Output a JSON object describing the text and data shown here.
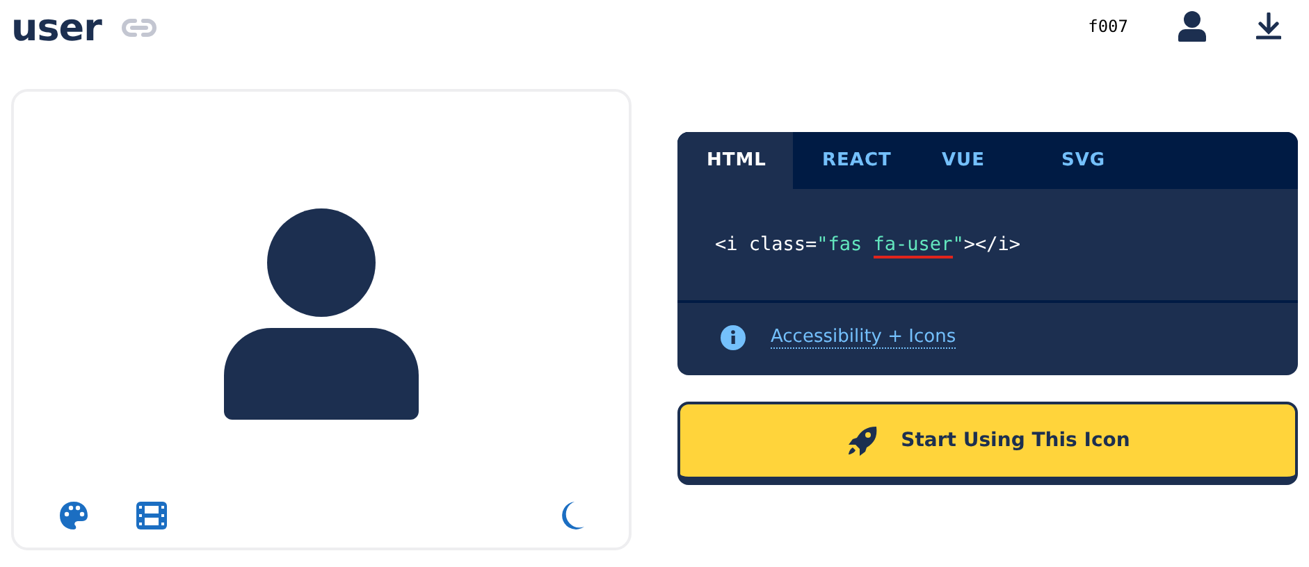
{
  "header": {
    "title": "user",
    "unicode": "f007"
  },
  "tabs": [
    {
      "label": "HTML",
      "selected": true
    },
    {
      "label": "REACT",
      "selected": false
    },
    {
      "label": "VUE",
      "selected": false
    },
    {
      "label": "SVG",
      "selected": false
    }
  ],
  "code": [
    {
      "kind": "plain",
      "text": "<i class="
    },
    {
      "kind": "string",
      "text": "\"fas "
    },
    {
      "kind": "highlight",
      "text": "fa-user"
    },
    {
      "kind": "string",
      "text": "\""
    },
    {
      "kind": "plain",
      "text": "></i>"
    }
  ],
  "link": "Accessibility + Icons",
  "cta": "Start Using This Icon"
}
